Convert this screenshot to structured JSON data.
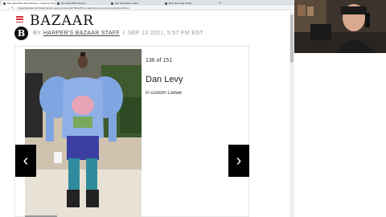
{
  "browser": {
    "tabs": [
      {
        "label": "Met Gala 2021 Best Dressed - Celebrity Red Carpet Looks",
        "active": true
      },
      {
        "label": "Met Gala 2021 Photos",
        "active": false
      },
      {
        "label": "Met Gala 2021 Looks",
        "active": false
      },
      {
        "label": "Best Met Gala Outfits",
        "active": false
      }
    ],
    "tab_add": "+",
    "url": "harpersbazaar.com/celebrity/red-carpet-dresses/g37523145/met-gala-2021-red-carpet-celebrity-fashion/"
  },
  "header": {
    "logo": "BAZAAR"
  },
  "byline": {
    "badge": "B",
    "by": "BY",
    "author": "HARPER'S BAZAAR STAFF",
    "separator": "/",
    "date": "SEP 13 2021, 5:57 PM EDT"
  },
  "gallery": {
    "counter": "136 of 151",
    "name": "Dan Levy",
    "caption": "in custom Loewe",
    "prev_glyph": "‹",
    "next_glyph": "›"
  },
  "colors": {
    "accent": "#d7323a",
    "text": "#111111"
  }
}
